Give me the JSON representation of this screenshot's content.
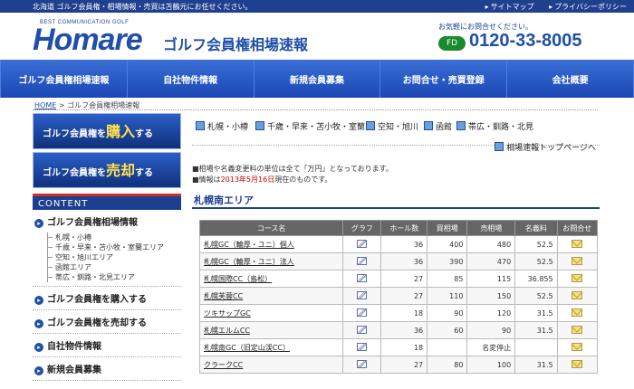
{
  "topbar": {
    "tagline": "北海道 ゴルフ会員権・相場情報・売買は苫鶴元にお任せください。",
    "links": [
      "サイトマップ",
      "プライバシーポリシー"
    ]
  },
  "header": {
    "brand_sub": "BEST COMMUNICATION GOLF",
    "brand": "Homare",
    "site_title": "ゴルフ会員権相場速報",
    "contact_label": "お気軽にお問合せください。",
    "freedial": "FD",
    "phone": "0120-33-8005"
  },
  "nav": [
    "ゴルフ会員権相場速報",
    "自社物件情報",
    "新規会員募集",
    "お問合せ・売買登録",
    "会社概要"
  ],
  "breadcrumb": {
    "home": "HOME",
    "current": " > ゴルフ会員権相場速報"
  },
  "sidebar": {
    "banner_buy": {
      "pre": "ゴルフ会員権を",
      "big": "購入",
      "post": "する"
    },
    "banner_sell": {
      "pre": "ゴルフ会員権を",
      "big": "売却",
      "post": "する"
    },
    "content_header": "CONTENT",
    "menu": [
      {
        "label": "ゴルフ会員権相場情報",
        "sub": [
          "札幌・小樽",
          "千歳・早来・苫小牧・室蘭エリア",
          "空知・旭川エリア",
          "函館エリア",
          "帯広・釧路・北見エリア"
        ]
      },
      {
        "label": "ゴルフ会員権を購入する"
      },
      {
        "label": "ゴルフ会員権を売却する"
      },
      {
        "label": "自社物件情報"
      },
      {
        "label": "新規会員募集"
      }
    ]
  },
  "main": {
    "areas": [
      "札幌・小樽",
      "千歳・早来・苫小牧・室蘭",
      "空知・旭川",
      "函館",
      "帯広・釧路・北見"
    ],
    "top_link": "相場速報トップページへ",
    "note1": "■相場や名義変更料の単位は全て「万円」となっております。",
    "note2_pre": "■情報は",
    "note2_date": "2013年5月16日",
    "note2_post": "現在のものです。",
    "section_title": "札幌南エリア",
    "table": {
      "headers": [
        "コース名",
        "グラフ",
        "ホール数",
        "買相場",
        "売相場",
        "名義料",
        "お問合せ"
      ],
      "rows": [
        {
          "name": "札幌GC（輪厚・ユニ）個人",
          "holes": "36",
          "buy": "400",
          "sell": "480",
          "fee": "52.5"
        },
        {
          "name": "札幌GC（輪厚・ユニ）法人",
          "holes": "36",
          "buy": "390",
          "sell": "470",
          "fee": "52.5"
        },
        {
          "name": "札幌国際CC（島松）",
          "holes": "27",
          "buy": "85",
          "sell": "115",
          "fee": "36.855"
        },
        {
          "name": "札幌芙蓉CC",
          "holes": "27",
          "buy": "110",
          "sell": "150",
          "fee": "52.5"
        },
        {
          "name": "ツキサップGC",
          "holes": "18",
          "buy": "90",
          "sell": "120",
          "fee": "31.5"
        },
        {
          "name": "札幌エルムCC",
          "holes": "36",
          "buy": "60",
          "sell": "90",
          "fee": "31.5"
        },
        {
          "name": "札幌南GC（旧定山渓CC）",
          "holes": "18",
          "buy": "",
          "sell": "名変停止",
          "fee": ""
        },
        {
          "name": "クラークCC",
          "holes": "27",
          "buy": "80",
          "sell": "100",
          "fee": "31.5"
        }
      ]
    }
  }
}
